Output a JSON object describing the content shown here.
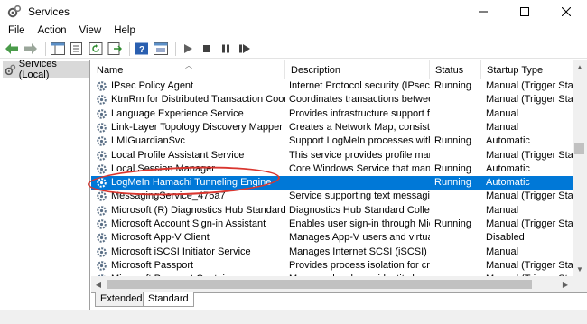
{
  "window": {
    "title": "Services",
    "app_icon": "gears-icon",
    "controls": {
      "minimize": "—",
      "maximize": "☐",
      "close": "✕"
    }
  },
  "menu": [
    "File",
    "Action",
    "View",
    "Help"
  ],
  "toolbar": {
    "buttons": [
      "back-icon",
      "forward-icon",
      "show-tree-icon",
      "properties-icon",
      "refresh-icon",
      "export-icon",
      "help-icon",
      "console-icon",
      "start-icon",
      "stop-icon",
      "pause-icon",
      "restart-icon"
    ]
  },
  "tree": {
    "root_label": "Services (Local)"
  },
  "columns": {
    "name": "Name",
    "description": "Description",
    "status": "Status",
    "startup": "Startup Type"
  },
  "services": [
    {
      "name": "IPsec Policy Agent",
      "description": "Internet Protocol security (IPsec) ...",
      "status": "Running",
      "startup": "Manual (Trigger Start)"
    },
    {
      "name": "KtmRm for Distributed Transaction Coordin...",
      "description": "Coordinates transactions betwee...",
      "status": "",
      "startup": "Manual (Trigger Start)"
    },
    {
      "name": "Language Experience Service",
      "description": "Provides infrastructure support fo...",
      "status": "",
      "startup": "Manual"
    },
    {
      "name": "Link-Layer Topology Discovery Mapper",
      "description": "Creates a Network Map, consistin...",
      "status": "",
      "startup": "Manual"
    },
    {
      "name": "LMIGuardianSvc",
      "description": "Support LogMeIn processes with ...",
      "status": "Running",
      "startup": "Automatic"
    },
    {
      "name": "Local Profile Assistant Service",
      "description": "This service provides profile man...",
      "status": "",
      "startup": "Manual (Trigger Start)"
    },
    {
      "name": "Local Session Manager",
      "description": "Core Windows Service that mana...",
      "status": "Running",
      "startup": "Automatic"
    },
    {
      "name": "LogMeIn Hamachi Tunneling Engine",
      "description": "",
      "status": "Running",
      "startup": "Automatic",
      "selected": true
    },
    {
      "name": "MessagingService_476a7",
      "description": "Service supporting text messagin...",
      "status": "",
      "startup": "Manual (Trigger Start)"
    },
    {
      "name": "Microsoft (R) Diagnostics Hub Standard Coll...",
      "description": "Diagnostics Hub Standard Collect...",
      "status": "",
      "startup": "Manual"
    },
    {
      "name": "Microsoft Account Sign-in Assistant",
      "description": "Enables user sign-in through Micr...",
      "status": "Running",
      "startup": "Manual (Trigger Start)"
    },
    {
      "name": "Microsoft App-V Client",
      "description": "Manages App-V users and virtual ...",
      "status": "",
      "startup": "Disabled"
    },
    {
      "name": "Microsoft iSCSI Initiator Service",
      "description": "Manages Internet SCSI (iSCSI) ses...",
      "status": "",
      "startup": "Manual"
    },
    {
      "name": "Microsoft Passport",
      "description": "Provides process isolation for cry...",
      "status": "",
      "startup": "Manual (Trigger Start)"
    },
    {
      "name": "Microsoft Passport Container",
      "description": "Manages local user identity keys ...",
      "status": "",
      "startup": "Manual (Trigger Start)"
    }
  ],
  "tabs": [
    "Extended",
    "Standard"
  ],
  "active_tab": "Standard",
  "colors": {
    "selection": "#0078d7",
    "annotation": "#d9362f"
  }
}
